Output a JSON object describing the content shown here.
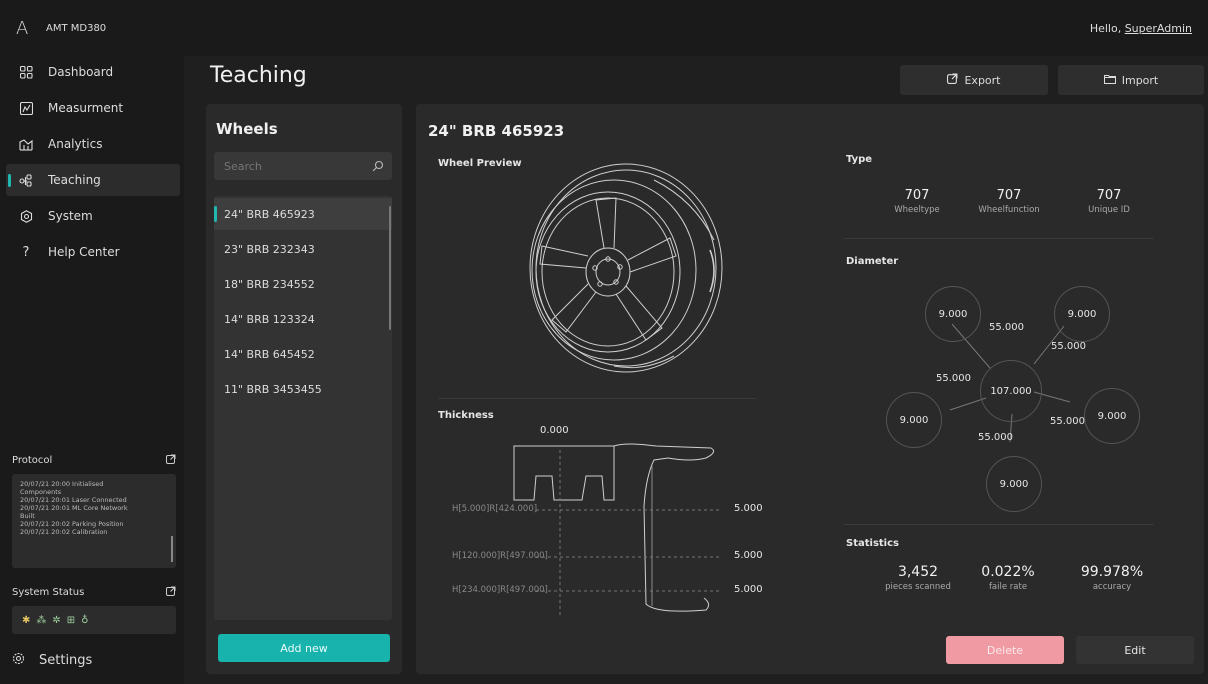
{
  "app": {
    "logo": "A",
    "title": "AMT MD380",
    "greeting_prefix": "Hello, ",
    "user": "SuperAdmin"
  },
  "nav": {
    "items": [
      {
        "label": "Dashboard",
        "icon": "dashboard-icon"
      },
      {
        "label": "Measurment",
        "icon": "measurement-icon"
      },
      {
        "label": "Analytics",
        "icon": "analytics-icon"
      },
      {
        "label": "Teaching",
        "icon": "teaching-icon",
        "active": true
      },
      {
        "label": "System",
        "icon": "system-icon"
      },
      {
        "label": "Help Center",
        "icon": "help-icon"
      }
    ],
    "protocol_label": "Protocol",
    "protocol_lines": [
      "20/07/21 20:00 Initialised",
      "Components",
      "20/07/21 20:01 Laser Connected",
      "20/07/21 20:01 ML Core Network",
      "Built",
      "20/07/21 20:02 Parking Position",
      "20/07/21 20:02 Calibration"
    ],
    "status_label": "System Status",
    "settings_label": "Settings"
  },
  "page": {
    "title": "Teaching",
    "export_label": "Export",
    "import_label": "Import"
  },
  "wheels": {
    "title": "Wheels",
    "search_placeholder": "Search",
    "items": [
      "24\" BRB 465923",
      "23\" BRB 232343",
      "18\" BRB 234552",
      "14\" BRB 123324",
      "14\" BRB 645452",
      "11\" BRB 3453455"
    ],
    "selected_index": 0,
    "add_label": "Add new"
  },
  "detail": {
    "title": "24\" BRB 465923",
    "preview_label": "Wheel Preview",
    "thickness": {
      "label": "Thickness",
      "top_value": "0.000",
      "rows": [
        {
          "label": "H[5.000]R[424.000]",
          "value": "5.000"
        },
        {
          "label": "H[120.000]R[497.000]",
          "value": "5.000"
        },
        {
          "label": "H[234.000]R[497.000]",
          "value": "5.000"
        }
      ]
    },
    "type": {
      "label": "Type",
      "cols": [
        {
          "value": "707",
          "label": "Wheeltype"
        },
        {
          "value": "707",
          "label": "Wheelfunction"
        },
        {
          "value": "707",
          "label": "Unique ID"
        }
      ]
    },
    "diameter": {
      "label": "Diameter",
      "center": "107.000",
      "outer": [
        "9.000",
        "9.000",
        "9.000",
        "9.000",
        "9.000"
      ],
      "links": [
        "55.000",
        "55.000",
        "55.000",
        "55.000",
        "55.000"
      ]
    },
    "statistics": {
      "label": "Statistics",
      "cols": [
        {
          "value": "3,452",
          "label": "pieces scanned"
        },
        {
          "value": "0.022%",
          "label": "faile rate"
        },
        {
          "value": "99.978%",
          "label": "accuracy"
        }
      ]
    },
    "delete_label": "Delete",
    "edit_label": "Edit"
  }
}
